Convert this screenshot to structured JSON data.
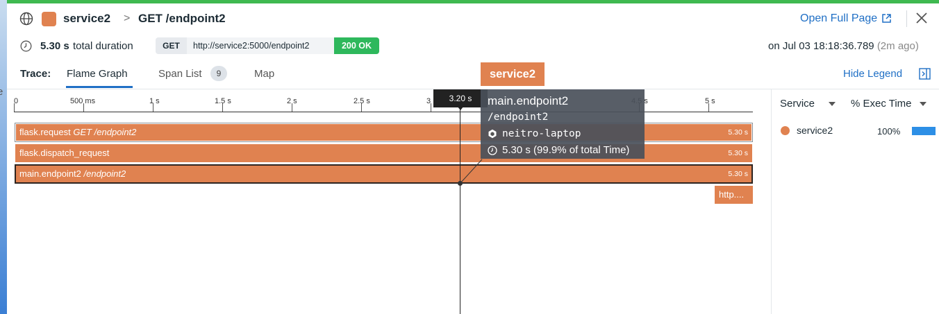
{
  "window": {
    "edge_char": "e"
  },
  "header": {
    "service_name": "service2",
    "service_color": "#e08250",
    "chevron": ">",
    "title": "GET /endpoint2",
    "open_full_page": "Open Full Page",
    "icons": [
      "globe-icon",
      "external-link-icon",
      "close-icon"
    ]
  },
  "meta": {
    "duration_value": "5.30 s",
    "duration_label": "total duration",
    "method": "GET",
    "url": "http://service2:5000/endpoint2",
    "status": "200 OK",
    "status_color": "#2eb85c",
    "date_prefix": "on Jul 03 18:18:36.789",
    "date_relative": "(2m ago)"
  },
  "tabs": {
    "trace_label": "Trace:",
    "items": [
      {
        "label": "Flame Graph",
        "active": true
      },
      {
        "label": "Span List",
        "count": "9"
      },
      {
        "label": "Map"
      }
    ],
    "hide_legend": "Hide Legend",
    "service_tag": "service2"
  },
  "flame_graph": {
    "time_axis": [
      "0",
      "500 ms",
      "1 s",
      "1.5 s",
      "2 s",
      "2.5 s",
      "3",
      "4.5 s",
      "5 s"
    ],
    "cursor_time": "3.20 s",
    "spans": [
      {
        "name": "flask.request",
        "resource": "GET /endpoint2",
        "duration": "5.30 s"
      },
      {
        "name": "flask.dispatch_request",
        "resource": "",
        "duration": "5.30 s"
      },
      {
        "name": "main.endpoint2",
        "resource": "/endpoint2",
        "duration": "5.30 s"
      },
      {
        "name": "http....",
        "resource": "",
        "duration": ""
      }
    ],
    "tooltip": {
      "title": "main.endpoint2",
      "resource": "/endpoint2",
      "host": "neitro-laptop",
      "time": "5.30 s (99.9% of total Time)"
    }
  },
  "legend": {
    "col_service": "Service",
    "col_exec": "% Exec Time",
    "rows": [
      {
        "service": "service2",
        "pct": "100%",
        "pct_value": 100,
        "color": "#e08250",
        "bar_color": "#2d8fe6"
      }
    ]
  }
}
